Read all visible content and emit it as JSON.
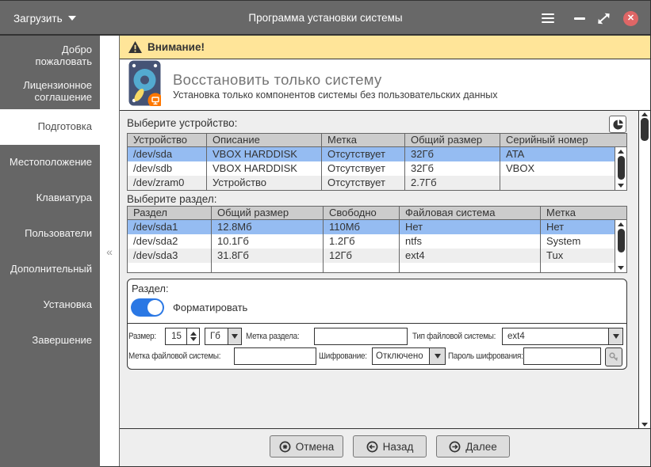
{
  "window": {
    "load_button": "Загрузить",
    "title": "Программа установки системы"
  },
  "sidebar": {
    "collapse_glyph": "«",
    "items": [
      {
        "id": "welcome",
        "label": "Добро пожаловать",
        "selected": false
      },
      {
        "id": "license",
        "label": "Лицензионное соглашение",
        "selected": false
      },
      {
        "id": "preparation",
        "label": "Подготовка",
        "selected": true
      },
      {
        "id": "location",
        "label": "Местоположение",
        "selected": false
      },
      {
        "id": "keyboard",
        "label": "Клавиатура",
        "selected": false
      },
      {
        "id": "users",
        "label": "Пользователи",
        "selected": false
      },
      {
        "id": "additional",
        "label": "Дополнительный",
        "selected": false
      },
      {
        "id": "install",
        "label": "Установка",
        "selected": false
      },
      {
        "id": "finish",
        "label": "Завершение",
        "selected": false
      }
    ]
  },
  "banner": {
    "text": "Внимание!"
  },
  "header": {
    "title": "Восстановить только систему",
    "subtitle": "Установка только компонентов системы без пользовательских данных"
  },
  "device_section": {
    "label": "Выберите устройство:",
    "table": {
      "headers": [
        "Устройство",
        "Описание",
        "Метка",
        "Общий размер",
        "Серийный номер"
      ],
      "rows": [
        [
          "/dev/sda",
          "VBOX HARDDISK",
          "Отсутствует",
          "32Гб",
          "ATA"
        ],
        [
          "/dev/sdb",
          "VBOX HARDDISK",
          "Отсутствует",
          "32Гб",
          "VBOX"
        ],
        [
          "/dev/zram0",
          "Устройство",
          "Отсутствует",
          "2.7Гб",
          ""
        ]
      ],
      "selected_row": 0
    }
  },
  "partition_section": {
    "label": "Выберите раздел:",
    "table": {
      "headers": [
        "Раздел",
        "Общий размер",
        "Свободно",
        "Файловая система",
        "Метка"
      ],
      "rows": [
        [
          "/dev/sda1",
          "12.8Мб",
          "110Мб",
          "Нет",
          "Нет"
        ],
        [
          "/dev/sda2",
          "10.1Гб",
          "1.2Гб",
          "ntfs",
          "System"
        ],
        [
          "/dev/sda3",
          "31.8Гб",
          "12Гб",
          "ext4",
          "Tux"
        ]
      ],
      "selected_row": 0
    }
  },
  "partition_panel": {
    "label": "Раздел:",
    "format_toggle": {
      "label": "Форматировать",
      "on": true
    },
    "size_label": "Размер:",
    "size_value": "15",
    "unit_value": "Гб",
    "partition_label_label": "Метка раздела:",
    "partition_label_value": "",
    "fs_type_label": "Тип файловой системы:",
    "fs_type_value": "ext4",
    "fs_label_label": "Метка файловой системы:",
    "fs_label_value": "",
    "encryption_label": "Шифрование:",
    "encryption_value": "Отключено",
    "password_label": "Пароль шифрования:",
    "password_value": ""
  },
  "footer": {
    "cancel_label": "Отмена",
    "back_label": "Назад",
    "next_label": "Далее"
  },
  "colors": {
    "accent": "#2b78e4",
    "selection": "#95bcf2",
    "warning-bg": "#ffe599",
    "close-red": "#df6666",
    "icon-blue": "#455375",
    "icon-cyan": "#53aad0",
    "icon-yellow": "#f5d865",
    "icon-orange": "#fe7700"
  }
}
